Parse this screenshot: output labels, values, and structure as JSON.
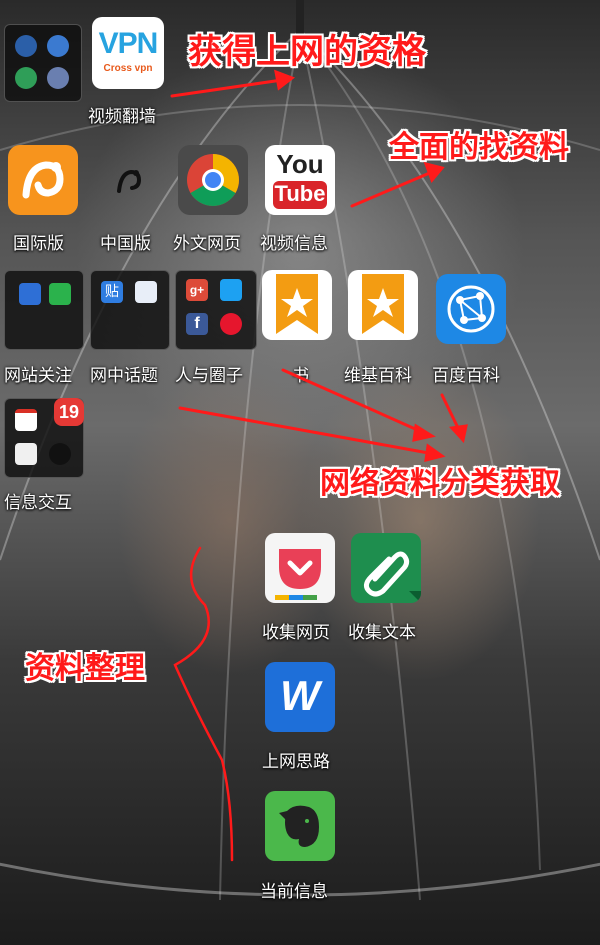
{
  "annotations": {
    "vpn": "获得上网的资格",
    "search": "全面的找资料",
    "categories": "网络资料分类获取",
    "organize": "资料整理"
  },
  "apps": {
    "vpn_folder": {
      "label": ""
    },
    "vpn": {
      "label": "视频翻墙",
      "logo_text": "VPN",
      "logo_sub": "Cross vpn"
    },
    "uc_intl": {
      "label": "国际版"
    },
    "uc_cn": {
      "label": "中国版"
    },
    "chrome": {
      "label": "外文网页"
    },
    "youtube": {
      "label": "视频信息",
      "logo_top": "You",
      "logo_bottom": "Tube"
    },
    "site_follow": {
      "label": "网站关注"
    },
    "topics": {
      "label": "网中话题",
      "tieba_char": "贴"
    },
    "social": {
      "label": "人与圈子",
      "gplus": "g+",
      "fb": "f"
    },
    "book": {
      "label": "书"
    },
    "wiki": {
      "label": "维基百科"
    },
    "baidu_baike": {
      "label": "百度百科"
    },
    "messages": {
      "label": "信息交互",
      "badge": "19"
    },
    "pocket": {
      "label": "收集网页"
    },
    "clipper": {
      "label": "收集文本"
    },
    "word": {
      "label": "上网思路",
      "logo": "W"
    },
    "evernote": {
      "label": "当前信息"
    }
  },
  "colors": {
    "annotation": "#ff1a1a",
    "uc_orange": "#f7941d",
    "bookmark_orange": "#f39c12",
    "baidu_blue": "#1e88e5",
    "pocket_red": "#e94057",
    "clipper_green": "#1e8e4e",
    "word_blue": "#1e6fd9",
    "evernote_green": "#4bb84b"
  }
}
